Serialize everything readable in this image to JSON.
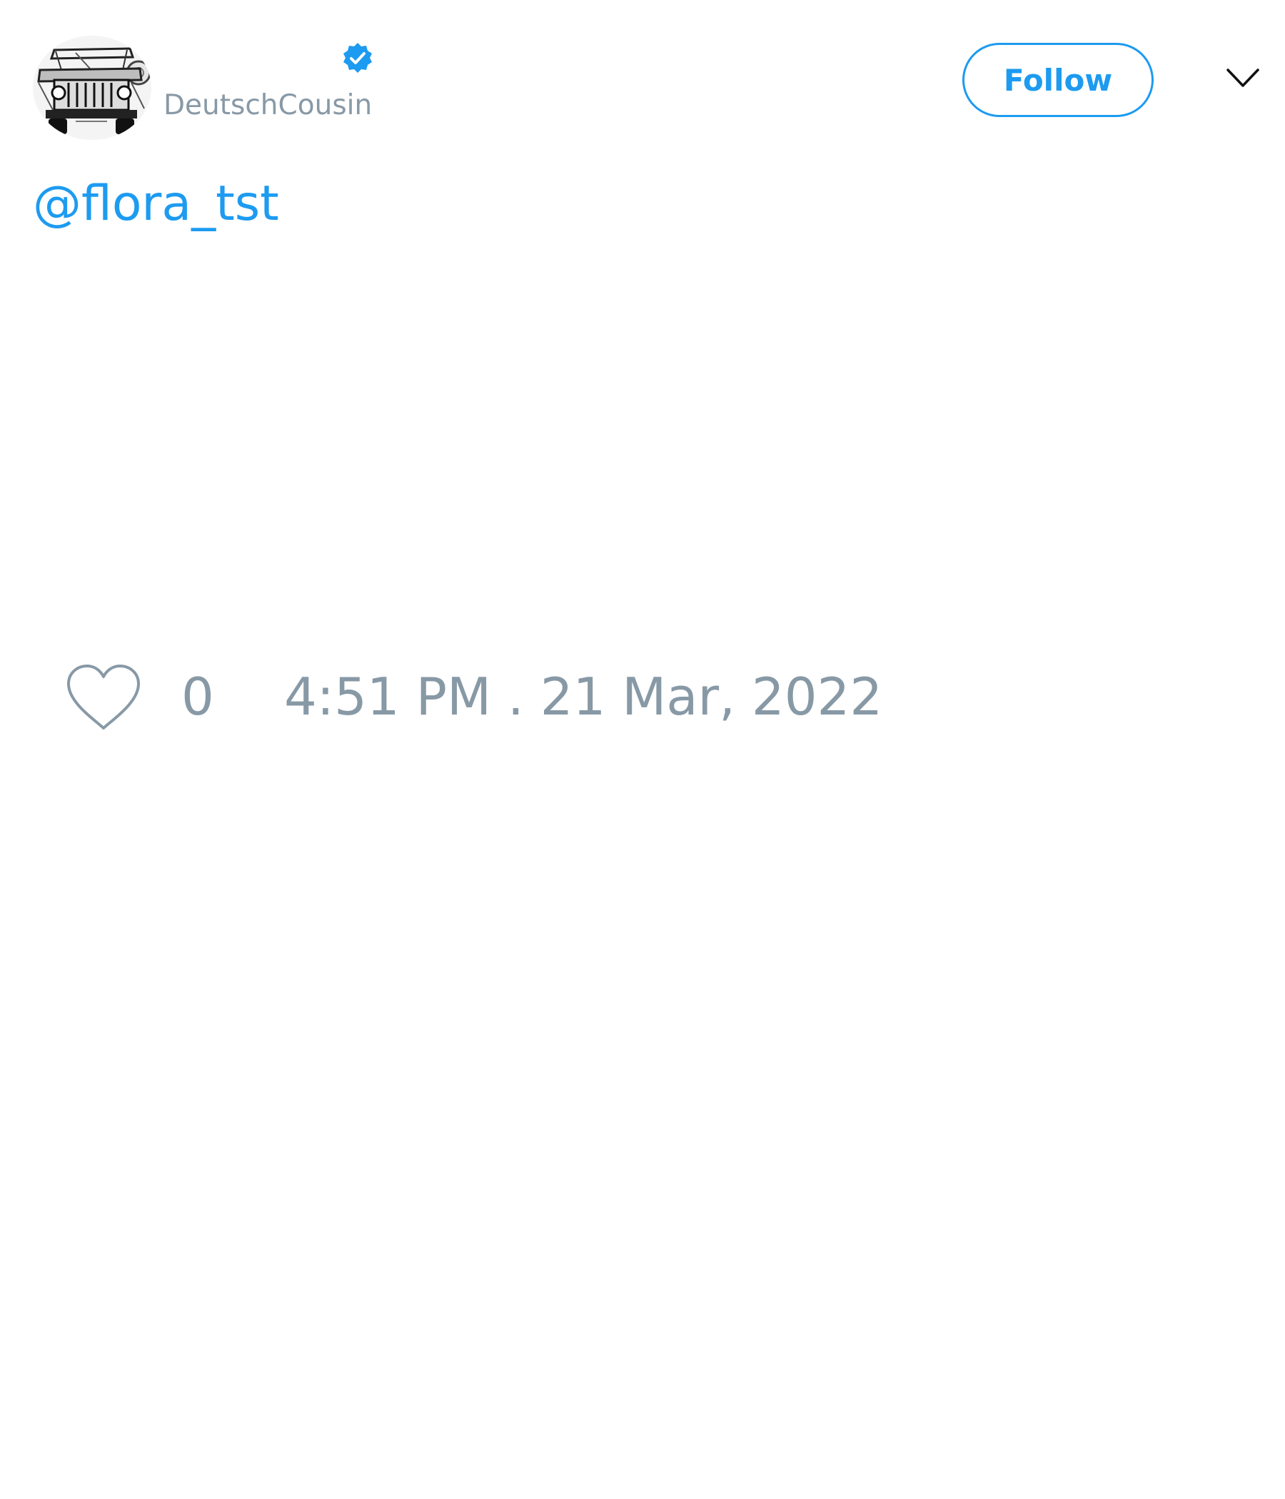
{
  "author": {
    "avatar_icon": "jeep-sketch-avatar",
    "verified_icon": "verified-badge-icon",
    "handle": "DeutschCousin"
  },
  "header": {
    "follow_label": "Follow",
    "menu_icon": "chevron-down-icon"
  },
  "tweet": {
    "text": "@flora_tst"
  },
  "footer": {
    "like_icon": "heart-outline-icon",
    "like_count": "0",
    "timestamp": "4:51 PM . 21 Mar, 2022"
  },
  "colors": {
    "accent": "#1d9bf0",
    "muted": "#8899a6",
    "background": "#ffffff"
  }
}
